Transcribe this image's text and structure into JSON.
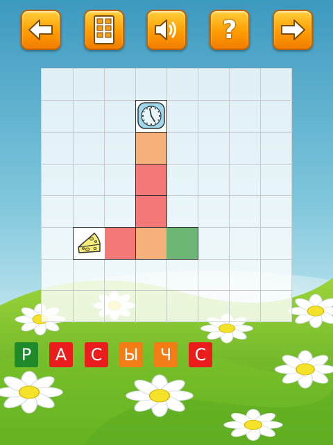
{
  "toolbar": {
    "buttons": [
      {
        "name": "back-button",
        "icon": "arrow-left-icon"
      },
      {
        "name": "levels-button",
        "icon": "grid-menu-icon"
      },
      {
        "name": "sound-button",
        "icon": "speaker-icon"
      },
      {
        "name": "help-button",
        "icon": "question-mark-icon",
        "label": "?"
      },
      {
        "name": "next-button",
        "icon": "arrow-right-icon"
      }
    ]
  },
  "board": {
    "columns": 8,
    "rows": 8,
    "start_icon": "clock-icon",
    "finish_icon": "cheese-icon",
    "path_colors": {
      "red": "#f47877",
      "orange": "#f6b07a",
      "green": "#6db676"
    }
  },
  "answer": {
    "letters": [
      {
        "char": "Р",
        "color": "#1f8a2a"
      },
      {
        "char": "А",
        "color": "#ea1c1c"
      },
      {
        "char": "С",
        "color": "#ea1c1c"
      },
      {
        "char": "Ы",
        "color": "#f47c14"
      },
      {
        "char": "Ч",
        "color": "#f47c14"
      },
      {
        "char": "С",
        "color": "#ea1c1c"
      }
    ]
  }
}
